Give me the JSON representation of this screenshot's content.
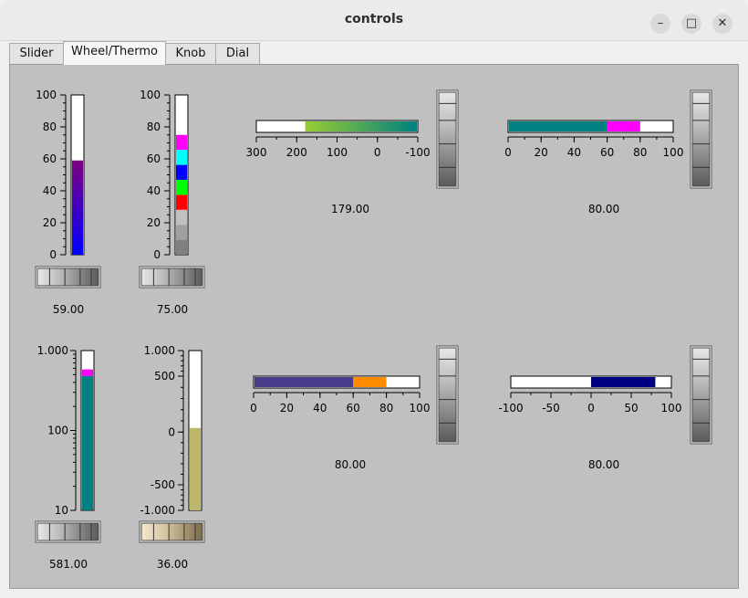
{
  "window": {
    "title": "controls"
  },
  "tabs": [
    "Slider",
    "Wheel/Thermo",
    "Knob",
    "Dial"
  ],
  "thermos": [
    {
      "orientation": "vertical",
      "min": 0,
      "max": 100,
      "value": 59,
      "scale": "linear",
      "ticks": [
        "100",
        "80",
        "60",
        "40",
        "20",
        "0"
      ],
      "tick_values": [
        100,
        80,
        60,
        40,
        20,
        0
      ],
      "fill": "gradient-blue-purple",
      "readout": "59.00"
    },
    {
      "orientation": "vertical",
      "min": 0,
      "max": 100,
      "value": 75,
      "scale": "linear",
      "ticks": [
        "100",
        "80",
        "60",
        "40",
        "20",
        "0"
      ],
      "tick_values": [
        100,
        80,
        60,
        40,
        20,
        0
      ],
      "fill": "color-bands",
      "band_colors": [
        "#808080",
        "#a0a0a0",
        "#c0c0c0",
        "#ff0000",
        "#00ff00",
        "#0000ff",
        "#00ffff",
        "#ff00ff"
      ],
      "readout": "75.00"
    },
    {
      "orientation": "horizontal",
      "min": 300,
      "max": -100,
      "value": 179,
      "scale": "linear",
      "ticks": [
        "300",
        "200",
        "100",
        "0",
        "-100"
      ],
      "tick_values": [
        300,
        200,
        100,
        0,
        -100
      ],
      "fill": "gradient-green-teal",
      "readout": "179.00"
    },
    {
      "orientation": "horizontal",
      "min": 0,
      "max": 100,
      "value": 80,
      "alarm": 60,
      "scale": "linear",
      "ticks": [
        "0",
        "20",
        "40",
        "60",
        "80",
        "100"
      ],
      "tick_values": [
        0,
        20,
        40,
        60,
        80,
        100
      ],
      "fill": "#008080",
      "alarm_color": "#ff00ff",
      "readout": "80.00"
    },
    {
      "orientation": "vertical",
      "min": 10,
      "max": 1000,
      "value": 581,
      "alarm": 480,
      "scale": "log",
      "ticks": [
        "1.000",
        "100",
        "10"
      ],
      "tick_values": [
        1000,
        100,
        10
      ],
      "fill": "#008080",
      "alarm_color": "#ff00ff",
      "readout": "581.00"
    },
    {
      "orientation": "vertical",
      "min": -1000,
      "max": 1000,
      "value": 36,
      "scale": "nonlinear",
      "ticks": [
        "1.000",
        "500",
        "0",
        "-500",
        "-1.000"
      ],
      "tick_values": [
        1000,
        500,
        0,
        -500,
        -1000
      ],
      "fill": "#bdb76b",
      "readout": "36.00"
    },
    {
      "orientation": "horizontal",
      "min": 0,
      "max": 100,
      "value": 80,
      "alarm": 60,
      "scale": "linear",
      "ticks": [
        "0",
        "20",
        "40",
        "60",
        "80",
        "100"
      ],
      "tick_values": [
        0,
        20,
        40,
        60,
        80,
        100
      ],
      "fill": "#483d8b",
      "alarm_color": "#ff8c00",
      "readout": "80.00"
    },
    {
      "orientation": "horizontal",
      "min": -100,
      "max": 100,
      "value": 80,
      "origin": 0,
      "scale": "linear",
      "ticks": [
        "-100",
        "-50",
        "0",
        "50",
        "100"
      ],
      "tick_values": [
        -100,
        -50,
        0,
        50,
        100
      ],
      "fill": "#000080",
      "readout": "80.00"
    }
  ],
  "wheels": [
    {
      "orientation": "horizontal",
      "style": "gray"
    },
    {
      "orientation": "horizontal",
      "style": "gray"
    },
    {
      "orientation": "vertical",
      "style": "gray"
    },
    {
      "orientation": "vertical",
      "style": "gray"
    },
    {
      "orientation": "horizontal",
      "style": "gray"
    },
    {
      "orientation": "horizontal",
      "style": "tan"
    },
    {
      "orientation": "vertical",
      "style": "gray"
    },
    {
      "orientation": "vertical",
      "style": "gray"
    }
  ],
  "icons": {
    "minimize": "minimize-icon",
    "maximize": "maximize-icon",
    "close": "close-icon"
  }
}
